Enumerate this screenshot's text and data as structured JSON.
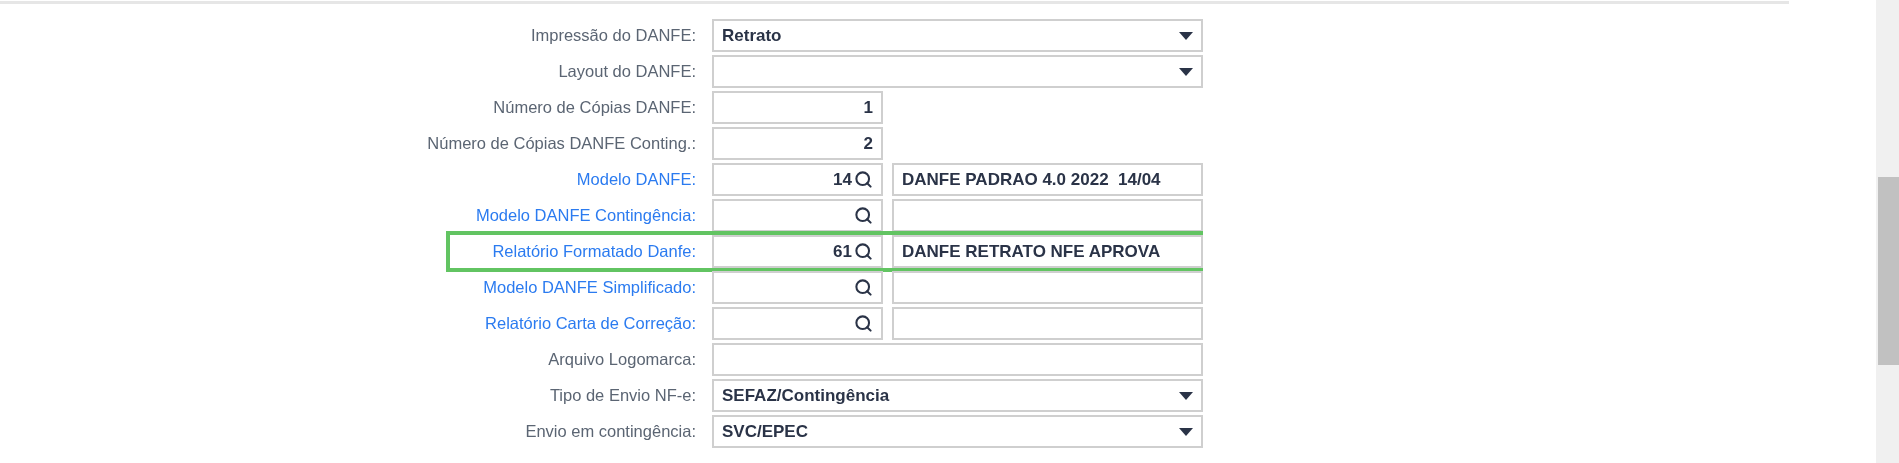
{
  "fields": [
    {
      "kind": "select",
      "label": "Impressão do DANFE:",
      "value": "Retrato",
      "highlighted": false
    },
    {
      "kind": "select",
      "label": "Layout do DANFE:",
      "highlighted": false
    },
    {
      "kind": "number",
      "label": "Número de Cópias DANFE:",
      "value": "1",
      "highlighted": false
    },
    {
      "kind": "number",
      "label": "Número de Cópias DANFE Conting.:",
      "value": "2",
      "highlighted": false
    },
    {
      "kind": "lookup",
      "label": "Modelo DANFE:",
      "code": "14",
      "description": "DANFE PADRAO 4.0 2022  14/04",
      "highlighted": false
    },
    {
      "kind": "lookup",
      "label": "Modelo DANFE Contingência:",
      "highlighted": false
    },
    {
      "kind": "lookup",
      "label": "Relatório Formatado Danfe:",
      "code": "61",
      "description": "DANFE RETRATO NFE APROVA",
      "highlighted": true
    },
    {
      "kind": "lookup",
      "label": "Modelo DANFE Simplificado:",
      "highlighted": false
    },
    {
      "kind": "lookup",
      "label": "Relatório Carta de Correção:",
      "highlighted": false
    },
    {
      "kind": "text",
      "label": "Arquivo Logomarca:",
      "highlighted": false
    },
    {
      "kind": "select",
      "label": "Tipo de Envio NF-e:",
      "value": "SEFAZ/Contingência",
      "highlighted": false
    },
    {
      "kind": "select",
      "label": "Envio em contingência:",
      "value": "SVC/EPEC",
      "highlighted": false
    }
  ]
}
